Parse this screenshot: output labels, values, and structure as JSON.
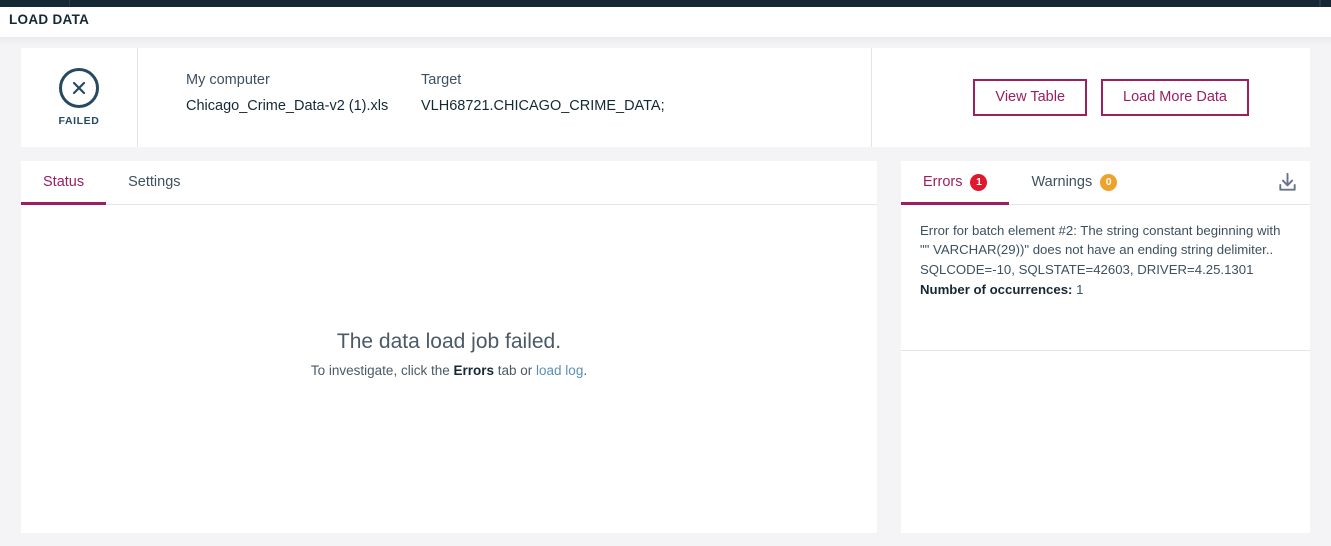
{
  "topbar": {
    "segments": 6
  },
  "header": {
    "title": "LOAD DATA"
  },
  "summary": {
    "status": {
      "label": "FAILED",
      "icon": "x-circle-icon",
      "color": "#264a60"
    },
    "source": {
      "label": "My computer",
      "value": "Chicago_Crime_Data-v2 (1).xls"
    },
    "target": {
      "label": "Target",
      "value": "VLH68721.CHICAGO_CRIME_DATA;"
    },
    "actions": {
      "view_table": "View Table",
      "load_more_data": "Load More Data",
      "accent": "#9b2063"
    }
  },
  "left_panel": {
    "tabs": [
      {
        "label": "Status",
        "active": true
      },
      {
        "label": "Settings",
        "active": false
      }
    ],
    "empty_state": {
      "title": "The data load job failed.",
      "sub_prefix": "To investigate, click the ",
      "sub_bold": "Errors",
      "sub_middle": " tab or ",
      "sub_link": "load log",
      "sub_suffix": "."
    }
  },
  "right_panel": {
    "tabs": [
      {
        "label": "Errors",
        "badge": "1",
        "badge_color": "#e0182d",
        "active": true
      },
      {
        "label": "Warnings",
        "badge": "0",
        "badge_color": "#efa12c",
        "active": false
      }
    ],
    "download_icon": "download-icon",
    "message": {
      "line1": "Error for batch element #2: The string constant beginning with",
      "line2": "\"\" VARCHAR(29))\" does not have an ending string delimiter..",
      "line3": "SQLCODE=-10, SQLSTATE=42603, DRIVER=4.25.1301",
      "occurrences_label": "Number of occurrences:",
      "occurrences_value": "1"
    }
  }
}
